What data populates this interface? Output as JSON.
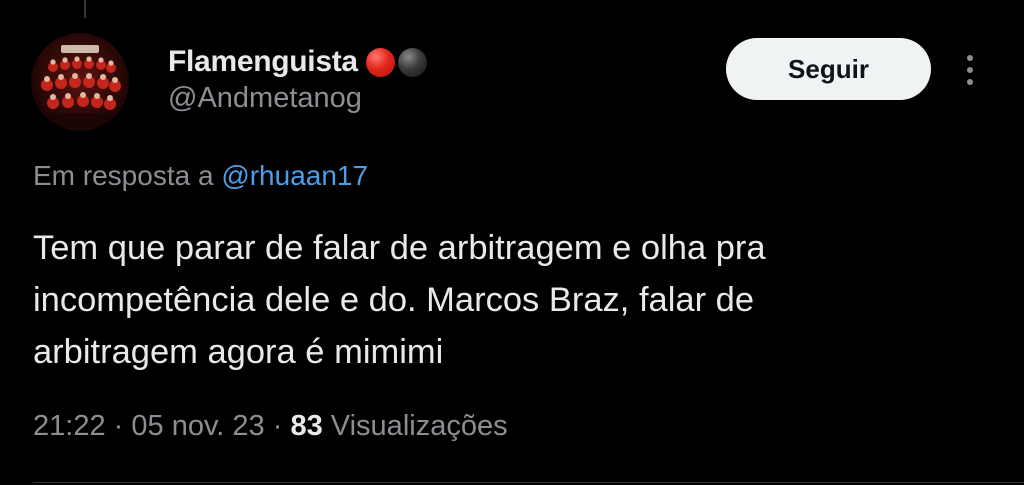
{
  "tweet": {
    "author": {
      "display_name": "Flamenguista",
      "handle": "@Andmetanog",
      "badges": [
        "red-circle-emoji",
        "black-circle-emoji"
      ]
    },
    "follow_label": "Seguir",
    "more_icon": "more-vertical-icon",
    "reply_prefix": "Em resposta a",
    "reply_mention": "@rhuaan17",
    "text_lines": [
      "Tem que parar de falar de arbitragem e olha pra",
      "incompetência dele e do. Marcos Braz, falar de",
      "arbitragem agora é mimimi"
    ],
    "time": "21:22",
    "date": "05 nov. 23",
    "separator": "·",
    "views_count": "83",
    "views_label": "Visualizações"
  },
  "colors": {
    "background": "#000000",
    "primary_text": "#e7e9ea",
    "secondary_text": "#8b8f94",
    "link": "#4a9fe8",
    "button_bg": "#eff3f4",
    "button_text": "#0f1419",
    "badge_red": "#e2261b",
    "badge_black": "#3a3a3a"
  }
}
